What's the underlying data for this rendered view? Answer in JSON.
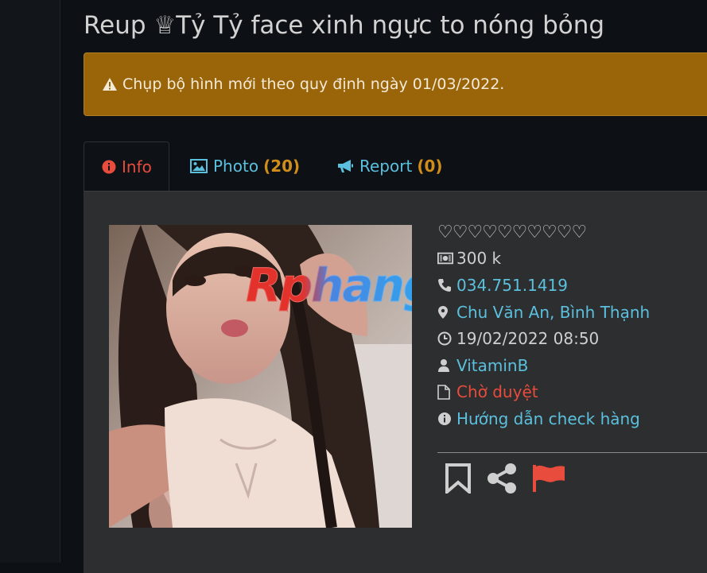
{
  "post": {
    "title": "Reup ♕Tỷ Tỷ face xinh ngực to nóng bỏng"
  },
  "alert": {
    "text": "Chụp bộ hình mới theo quy định ngày 01/03/2022.",
    "icon": "warning-icon"
  },
  "tabs": [
    {
      "label": "Info",
      "icon": "info-circle-icon",
      "active": true
    },
    {
      "label": "Photo",
      "count": "(20)",
      "icon": "image-icon"
    },
    {
      "label": "Report",
      "count": "(0)",
      "icon": "bullhorn-icon"
    }
  ],
  "photo": {
    "watermark": "Rphang"
  },
  "details": {
    "hearts": "♡♡♡♡♡♡♡♡♡♡",
    "price": "300 k",
    "phone": "034.751.1419",
    "address": "Chu Văn An, Bình Thạnh",
    "date": "19/02/2022 08:50",
    "user": "VitaminB",
    "status": "Chờ duyệt",
    "guide": "Hướng dẫn check hàng"
  },
  "actions": [
    {
      "name": "bookmark",
      "icon": "bookmark-icon"
    },
    {
      "name": "share",
      "icon": "share-icon"
    },
    {
      "name": "report",
      "icon": "flag-icon"
    }
  ],
  "colors": {
    "background": "#0d1014",
    "alert": "#9a6409",
    "panel": "#2d2e2f",
    "link": "#5bc0de",
    "danger": "#e74c3c",
    "count": "#d08d1a"
  }
}
